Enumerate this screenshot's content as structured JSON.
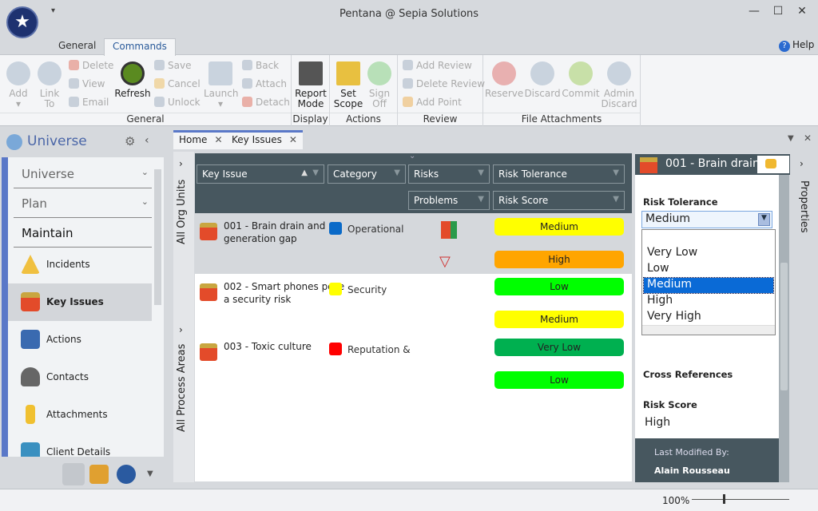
{
  "window": {
    "title": "Pentana @ Sepia Solutions",
    "minimize": "—",
    "maximize": "☐",
    "close": "✕",
    "quick_access": "▾"
  },
  "ribbon_tabs": [
    {
      "label": "General"
    },
    {
      "label": "Commands"
    }
  ],
  "help": "Help",
  "ribbon": {
    "general": {
      "label": "General",
      "add": "Add",
      "link_to": "Link To",
      "delete": "Delete",
      "view": "View",
      "email": "Email",
      "refresh": "Refresh",
      "save": "Save",
      "cancel": "Cancel",
      "unlock": "Unlock",
      "launch": "Launch",
      "back": "Back",
      "attach": "Attach",
      "detach": "Detach"
    },
    "display": {
      "label": "Display",
      "report_mode": "Report Mode"
    },
    "actions": {
      "label": "Actions",
      "set_scope": "Set Scope",
      "sign_off": "Sign Off"
    },
    "review": {
      "label": "Review",
      "add_review": "Add Review",
      "delete_review": "Delete Review",
      "add_point": "Add Point"
    },
    "file_attachments": {
      "label": "File Attachments",
      "reserve": "Reserve",
      "discard": "Discard",
      "commit": "Commit",
      "admin_discard": "Admin Discard"
    }
  },
  "left_panel": {
    "title": "Universe",
    "sections": [
      "Universe",
      "Plan",
      "Maintain"
    ],
    "items": [
      {
        "label": "Incidents"
      },
      {
        "label": "Key Issues"
      },
      {
        "label": "Actions"
      },
      {
        "label": "Contacts"
      },
      {
        "label": "Attachments"
      },
      {
        "label": "Client Details"
      }
    ]
  },
  "doc_tabs": [
    {
      "label": "Home"
    },
    {
      "label": "Key Issues"
    }
  ],
  "side_filters": {
    "org_units": "All Org Units",
    "process_areas": "All Process Areas"
  },
  "grid": {
    "columns": {
      "key_issue": "Key Issue",
      "category": "Category",
      "risks": "Risks",
      "risk_tolerance": "Risk Tolerance",
      "problems": "Problems",
      "risk_score": "Risk Score"
    },
    "rows": [
      {
        "title": "001 - Brain drain and generation gap",
        "category": "Operational",
        "category_color": "#0a6ac8",
        "risk_tolerance": "Medium",
        "risk_tolerance_color": "#ffff00",
        "risk_score": "High",
        "risk_score_color": "#ffa500",
        "selected": true
      },
      {
        "title": "002 - Smart phones pose a security risk",
        "category": "Security",
        "category_color": "#ffff00",
        "risk_tolerance": "Low",
        "risk_tolerance_color": "#00ff00",
        "risk_score": "Medium",
        "risk_score_color": "#ffff00"
      },
      {
        "title": "003 - Toxic culture",
        "category": "Reputation &",
        "category_color": "#ff0000",
        "risk_tolerance": "Very Low",
        "risk_tolerance_color": "#00b050",
        "risk_score": "Low",
        "risk_score_color": "#00ff00"
      }
    ]
  },
  "properties": {
    "header": "001 - Brain drain",
    "risk_tolerance_label": "Risk Tolerance",
    "risk_tolerance_value": "Medium",
    "options": [
      "Very Low",
      "Low",
      "Medium",
      "High",
      "Very High"
    ],
    "selected_option": "Medium",
    "cross_references_label": "Cross References",
    "risk_score_label": "Risk Score",
    "risk_score_value": "High",
    "last_modified_label": "Last Modified By:",
    "last_modified_value": "Alain Rousseau",
    "strip_label": "Properties"
  },
  "status": {
    "zoom": "100%"
  }
}
